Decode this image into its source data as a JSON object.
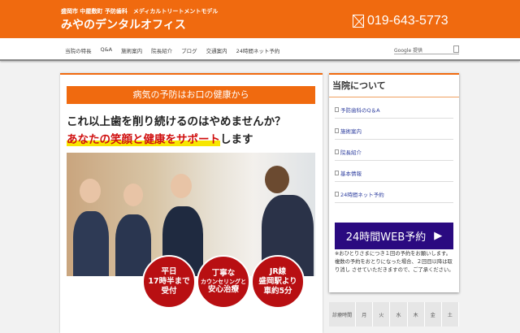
{
  "header": {
    "tagline": "盛岡市 中屋敷町 予防歯科　メディカルトリートメントモデル",
    "title": "みやのデンタルオフィス",
    "phone": "019-643-5773"
  },
  "nav": {
    "items": [
      "当院の特長",
      "Q&A",
      "施術案内",
      "院長紹介",
      "ブログ",
      "交通案内",
      "24時間ネット予約"
    ],
    "search_label": "Google 提供"
  },
  "main": {
    "banner": "病気の予防はお口の健康から",
    "headline1": "これ以上歯を削り続けるのはやめませんか？",
    "headline2_highlight": "あなたの笑顔と健康をサポート",
    "headline2_rest": "します",
    "circles": [
      {
        "l1": "平日",
        "l2": "17時半まで",
        "l3": "受付"
      },
      {
        "l1": "丁寧な",
        "l2": "カウンセリングと",
        "l3": "安心治療"
      },
      {
        "l1": "JR線",
        "l2": "盛岡駅より",
        "l3": "車約5分"
      }
    ]
  },
  "sidebar": {
    "title": "当院について",
    "items": [
      "予防歯科のQ＆A",
      "施術案内",
      "院長紹介",
      "基本情報",
      "24時間ネット予約"
    ],
    "web_button": "24時間WEB予約",
    "web_arrow": "▶",
    "note": "※おひとりさまにつき１回の予約をお願いします。 複数の予約をおとりになった場合、２回目以降は取り消し させていただきますので、ご了承ください。"
  },
  "schedule": {
    "headers": [
      "診療時間",
      "月",
      "火",
      "水",
      "木",
      "金",
      "土"
    ]
  }
}
